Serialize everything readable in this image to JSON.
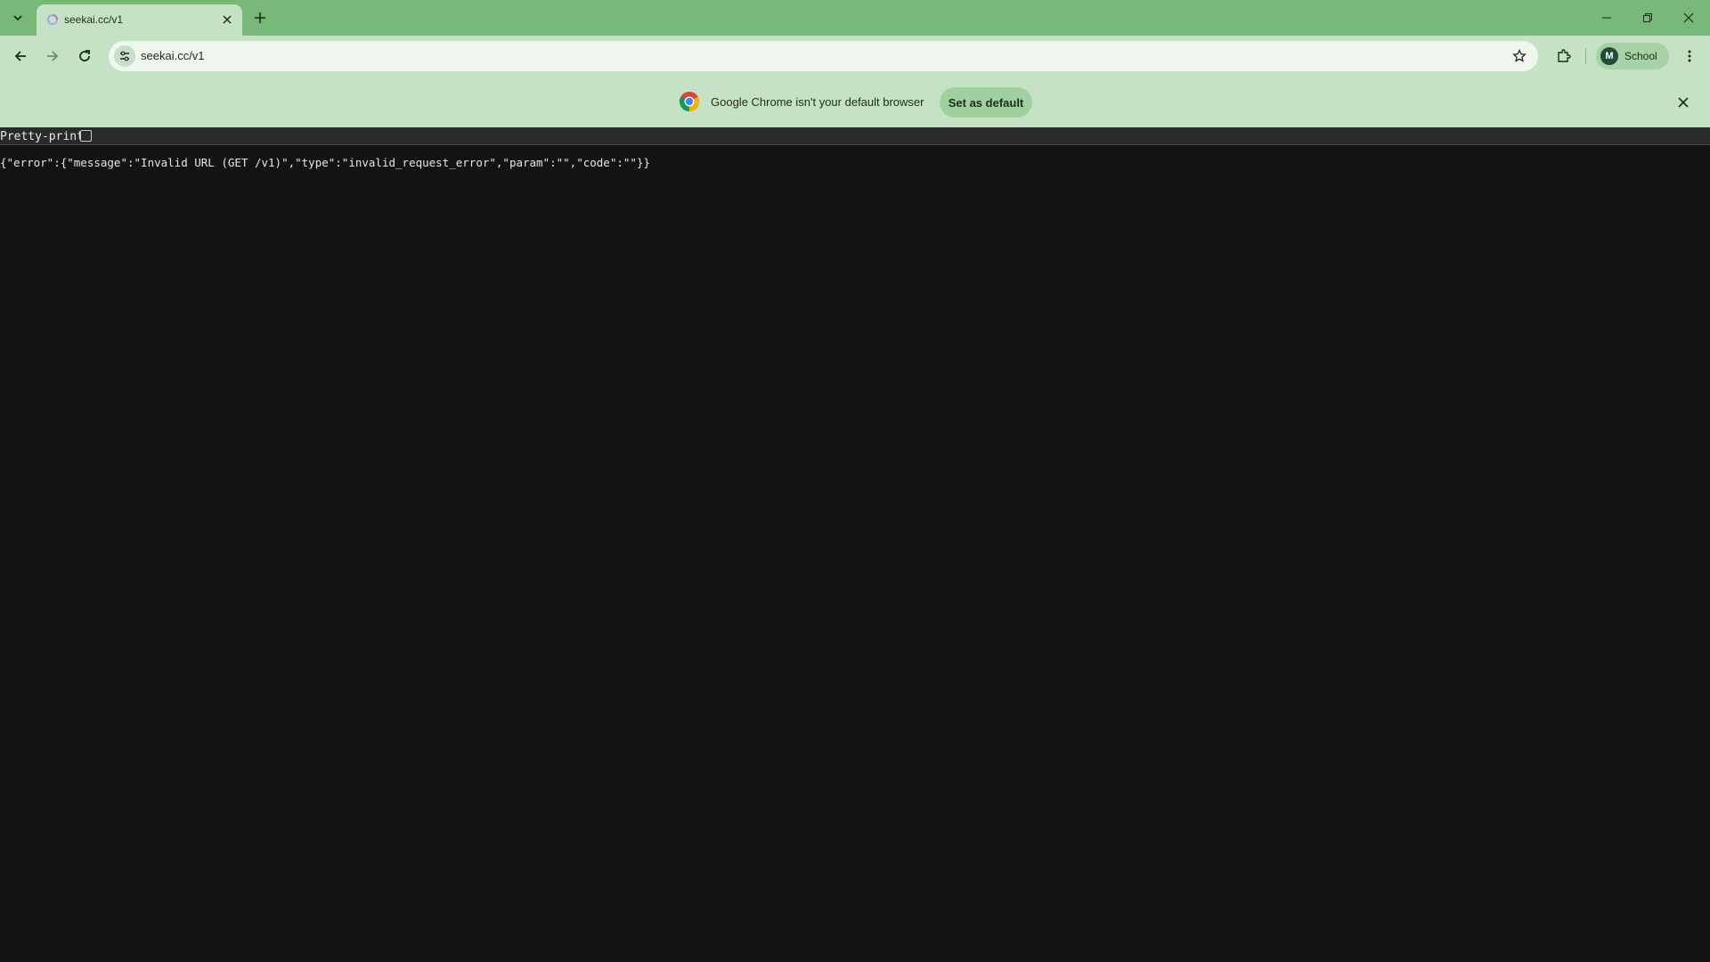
{
  "browser": {
    "tab": {
      "title": "seekai.cc/v1"
    },
    "address": {
      "url": "seekai.cc/v1"
    },
    "profile": {
      "initial": "M",
      "label": "School"
    },
    "theme_color": "#78b879"
  },
  "infobar": {
    "message": "Google Chrome isn't your default browser",
    "button_label": "Set as default"
  },
  "viewer": {
    "pretty_print_label": "Pretty-print",
    "pretty_print_checked": false,
    "json_text": "{\"error\":{\"message\":\"Invalid URL (GET /v1)\",\"type\":\"invalid_request_error\",\"param\":\"\",\"code\":\"\"}}"
  }
}
